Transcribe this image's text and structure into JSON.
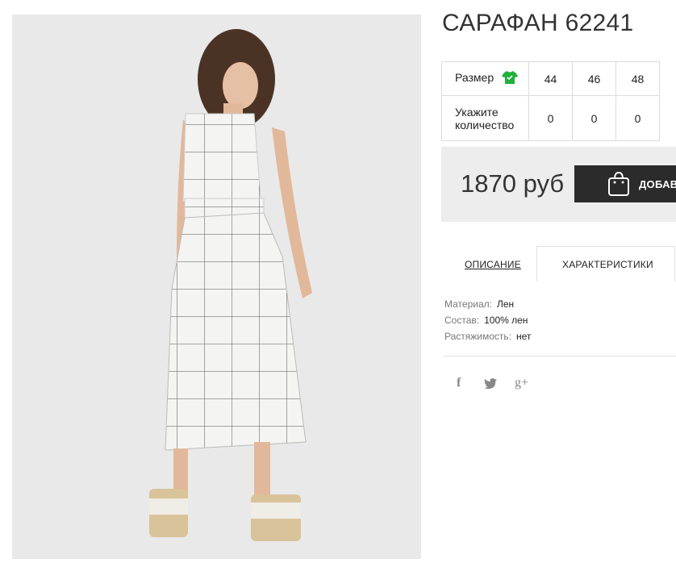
{
  "product": {
    "title": "САРАФАН 62241"
  },
  "size_table": {
    "size_label": "Размер",
    "sizes": [
      "44",
      "46",
      "48"
    ],
    "quantity_label_line1": "Укажите",
    "quantity_label_line2": "количество",
    "quantities": [
      "0",
      "0",
      "0"
    ],
    "size_icon": "shirt-icon",
    "size_icon_color": "#21b03a"
  },
  "purchase": {
    "price": "1870 руб",
    "add_button_label": "ДОБАВИТЬ",
    "bag_icon": "shopping-bag-icon"
  },
  "tabs": [
    {
      "label": "ОПИСАНИЕ",
      "active": false
    },
    {
      "label": "ХАРАКТЕРИСТИКИ",
      "active": true
    }
  ],
  "characteristics": [
    {
      "key": "Материал:",
      "value": "Лен"
    },
    {
      "key": "Состав:",
      "value": "100% лен"
    },
    {
      "key": "Растяжимость:",
      "value": "нет"
    }
  ],
  "social": {
    "facebook_glyph": "f",
    "twitter_icon": "twitter-icon",
    "googleplus_glyph": "g+"
  }
}
